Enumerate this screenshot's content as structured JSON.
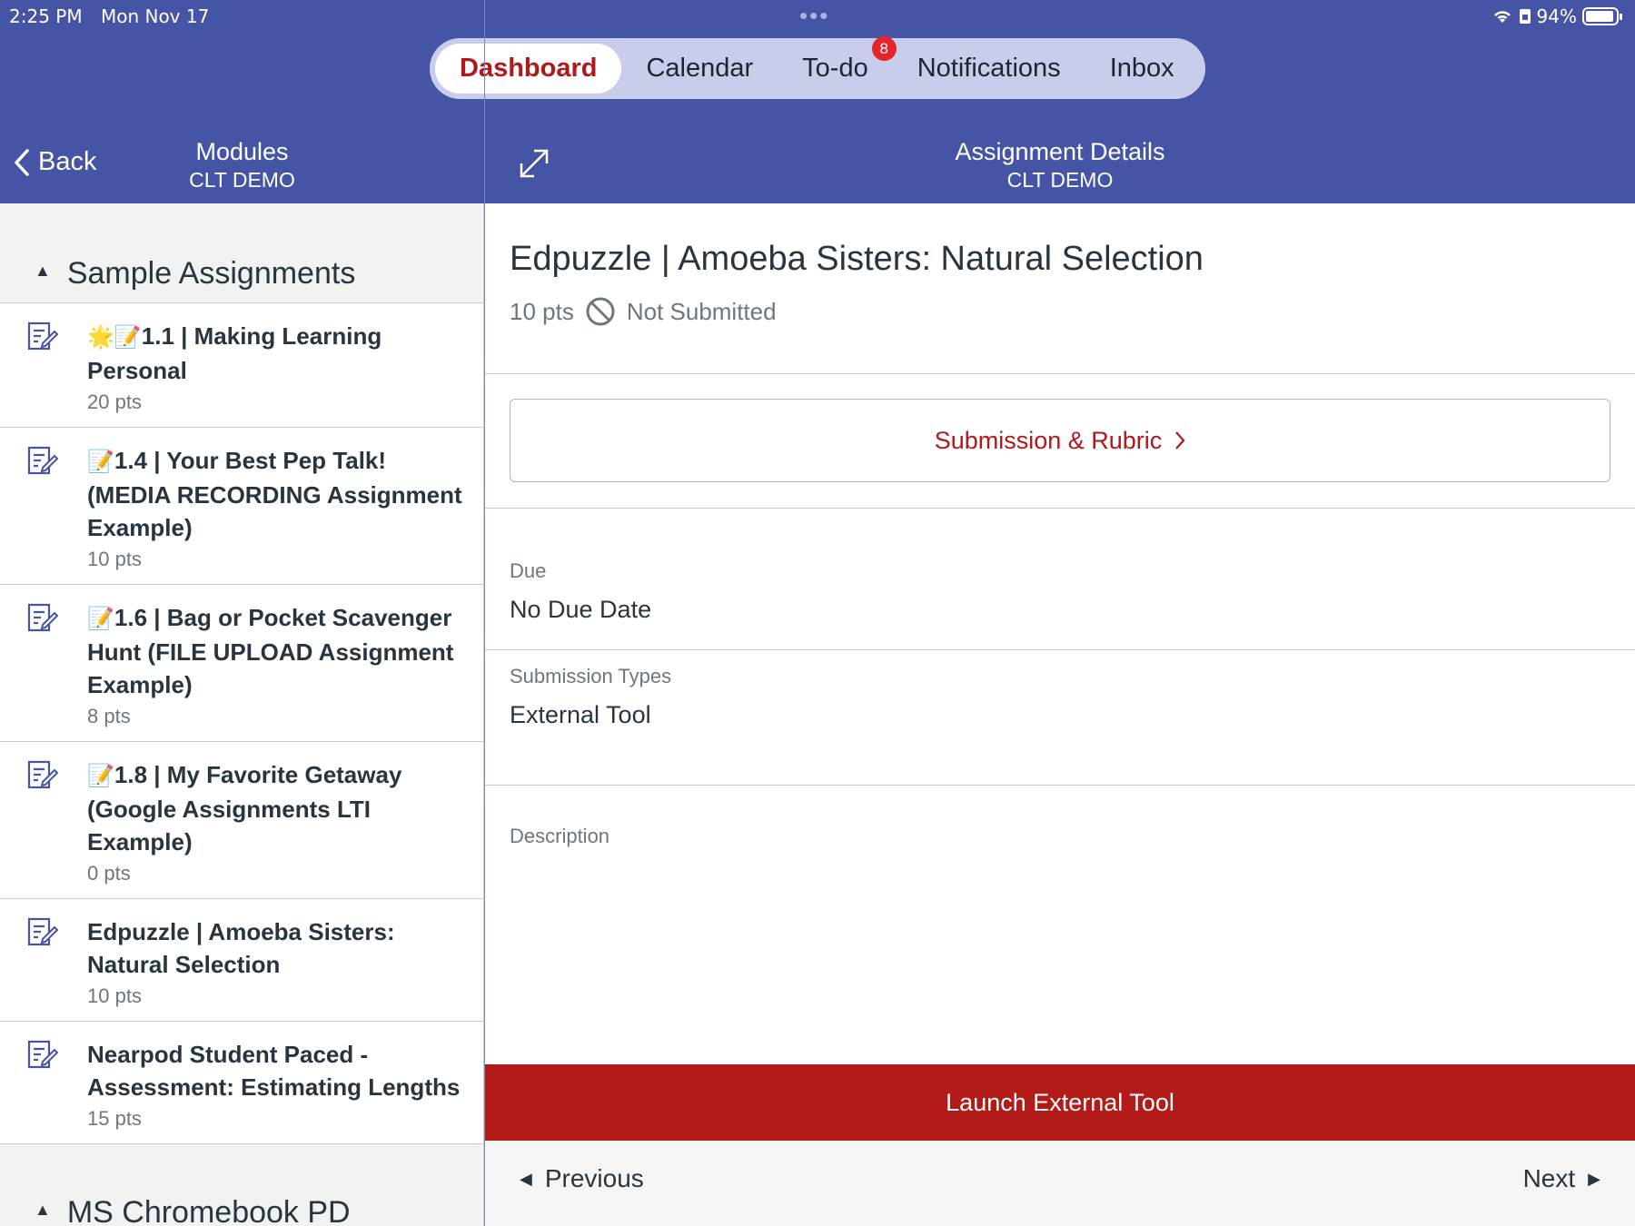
{
  "status_bar": {
    "time": "2:25 PM",
    "date": "Mon Nov 17",
    "battery": "94%",
    "battery_level": 0.94
  },
  "nav_tabs": [
    {
      "label": "Dashboard",
      "active": true
    },
    {
      "label": "Calendar"
    },
    {
      "label": "To-do",
      "badge": "8"
    },
    {
      "label": "Notifications"
    },
    {
      "label": "Inbox"
    }
  ],
  "left_header": {
    "back_label": "Back",
    "title": "Modules",
    "subtitle": "CLT DEMO"
  },
  "right_header": {
    "title": "Assignment Details",
    "subtitle": "CLT DEMO"
  },
  "modules": {
    "section1": "Sample Assignments",
    "items": [
      {
        "emoji": "🌟📝",
        "name": "1.1 | Making Learning Personal",
        "pts": "20 pts"
      },
      {
        "emoji": "📝",
        "name": "1.4 | Your Best Pep Talk! (MEDIA RECORDING Assignment Example)",
        "pts": "10 pts"
      },
      {
        "emoji": "📝",
        "name": "1.6 | Bag or Pocket Scavenger Hunt (FILE UPLOAD Assignment Example)",
        "pts": "8 pts"
      },
      {
        "emoji": "📝",
        "name": "1.8 | My Favorite Getaway (Google Assignments LTI Example)",
        "pts": "0 pts"
      },
      {
        "name": "Edpuzzle | Amoeba Sisters: Natural Selection",
        "pts": "10 pts"
      },
      {
        "name": "Nearpod Student Paced - Assessment: Estimating Lengths",
        "pts": "15 pts"
      }
    ],
    "section2": "MS Chromebook PD"
  },
  "assignment": {
    "title": "Edpuzzle | Amoeba Sisters: Natural Selection",
    "points": "10 pts",
    "status": "Not Submitted",
    "submission_button": "Submission & Rubric",
    "due_label": "Due",
    "due_value": "No Due Date",
    "types_label": "Submission Types",
    "types_value": "External Tool",
    "description_label": "Description",
    "launch_label": "Launch External Tool",
    "prev_label": "Previous",
    "next_label": "Next"
  },
  "colors": {
    "header": "#4554a4",
    "accent": "#b0181b",
    "launch": "#b31b18"
  }
}
